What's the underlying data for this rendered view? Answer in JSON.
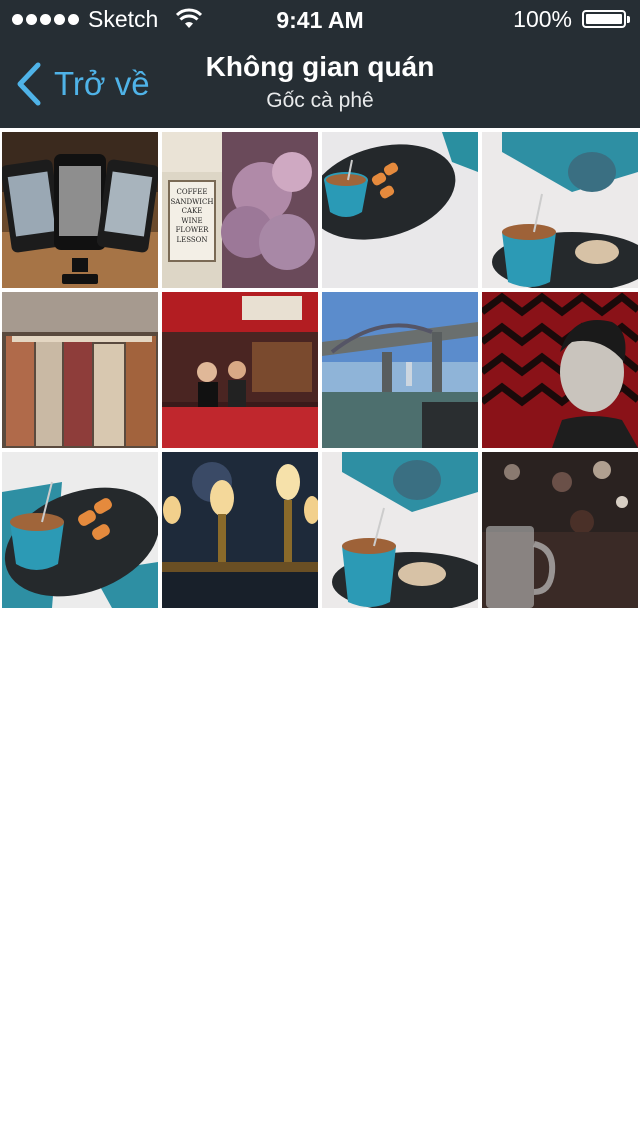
{
  "status_bar": {
    "carrier": "Sketch",
    "time": "9:41 AM",
    "battery": "100%"
  },
  "nav": {
    "back_label": "Trở về",
    "title": "Không gian quán",
    "subtitle": "Gốc cà phê"
  },
  "gallery": {
    "sign_lines": [
      "COFFEE",
      "SANDWICH",
      "CAKE",
      "WINE",
      "FLOWER",
      "LESSON"
    ]
  },
  "colors": {
    "nav_bg": "#262e34",
    "accent": "#4fb3e8"
  }
}
